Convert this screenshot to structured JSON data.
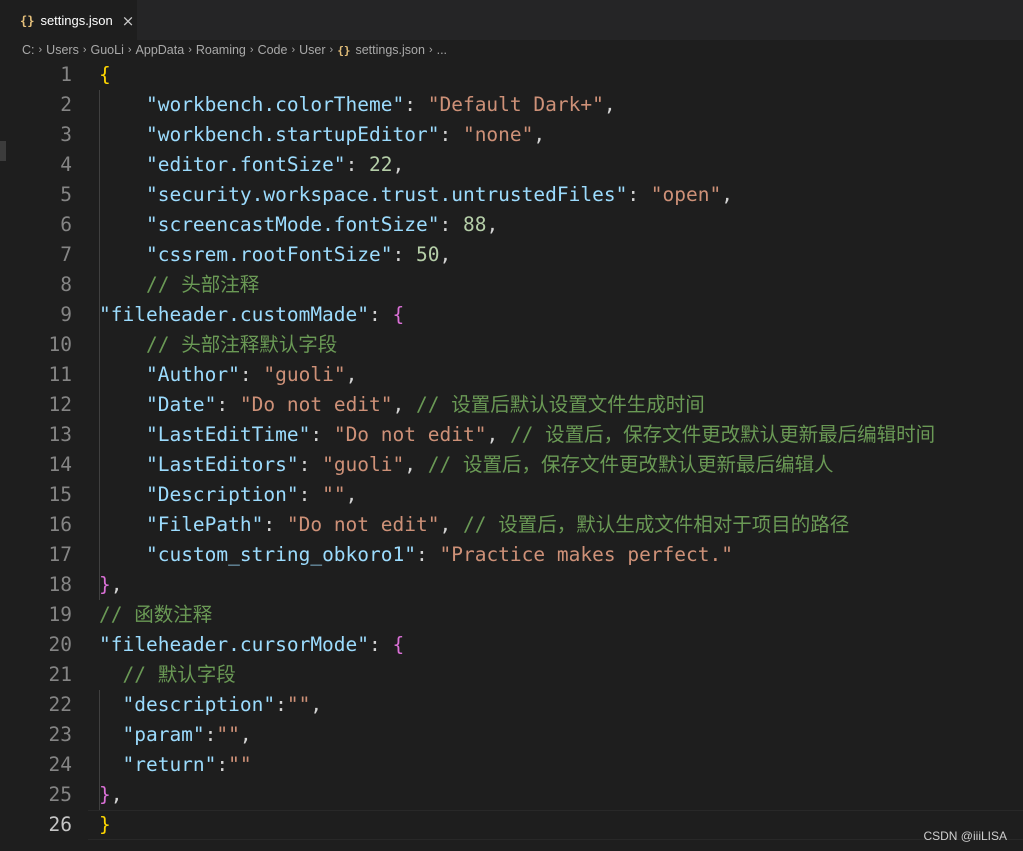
{
  "tab": {
    "icon": "{}",
    "label": "settings.json",
    "close": "×"
  },
  "breadcrumb": {
    "items": [
      "C:",
      "Users",
      "GuoLi",
      "AppData",
      "Roaming",
      "Code",
      "User"
    ],
    "file_icon": "{}",
    "file": "settings.json",
    "more": "..."
  },
  "lines": [
    {
      "n": "1",
      "tokens": [
        {
          "t": "{",
          "c": "b1"
        }
      ]
    },
    {
      "n": "2",
      "tokens": [
        {
          "t": "    "
        },
        {
          "t": "\"workbench.colorTheme\"",
          "c": "k"
        },
        {
          "t": ": ",
          "c": "p"
        },
        {
          "t": "\"Default Dark+\"",
          "c": "s"
        },
        {
          "t": ",",
          "c": "p"
        }
      ]
    },
    {
      "n": "3",
      "tokens": [
        {
          "t": "    "
        },
        {
          "t": "\"workbench.startupEditor\"",
          "c": "k"
        },
        {
          "t": ": ",
          "c": "p"
        },
        {
          "t": "\"none\"",
          "c": "s"
        },
        {
          "t": ",",
          "c": "p"
        }
      ]
    },
    {
      "n": "4",
      "tokens": [
        {
          "t": "    "
        },
        {
          "t": "\"editor.fontSize\"",
          "c": "k"
        },
        {
          "t": ": ",
          "c": "p"
        },
        {
          "t": "22",
          "c": "n"
        },
        {
          "t": ",",
          "c": "p"
        }
      ]
    },
    {
      "n": "5",
      "tokens": [
        {
          "t": "    "
        },
        {
          "t": "\"security.workspace.trust.untrustedFiles\"",
          "c": "k"
        },
        {
          "t": ": ",
          "c": "p"
        },
        {
          "t": "\"open\"",
          "c": "s"
        },
        {
          "t": ",",
          "c": "p"
        }
      ]
    },
    {
      "n": "6",
      "tokens": [
        {
          "t": "    "
        },
        {
          "t": "\"screencastMode.fontSize\"",
          "c": "k"
        },
        {
          "t": ": ",
          "c": "p"
        },
        {
          "t": "88",
          "c": "n"
        },
        {
          "t": ",",
          "c": "p"
        }
      ]
    },
    {
      "n": "7",
      "tokens": [
        {
          "t": "    "
        },
        {
          "t": "\"cssrem.rootFontSize\"",
          "c": "k"
        },
        {
          "t": ": ",
          "c": "p"
        },
        {
          "t": "50",
          "c": "n"
        },
        {
          "t": ",",
          "c": "p"
        }
      ]
    },
    {
      "n": "8",
      "tokens": [
        {
          "t": "    "
        },
        {
          "t": "// 头部注释",
          "c": "c"
        }
      ]
    },
    {
      "n": "9",
      "tokens": [
        {
          "t": "\"fileheader.customMade\"",
          "c": "k"
        },
        {
          "t": ": ",
          "c": "p"
        },
        {
          "t": "{",
          "c": "b2"
        }
      ]
    },
    {
      "n": "10",
      "tokens": [
        {
          "t": "    "
        },
        {
          "t": "// 头部注释默认字段",
          "c": "c"
        }
      ]
    },
    {
      "n": "11",
      "tokens": [
        {
          "t": "    "
        },
        {
          "t": "\"Author\"",
          "c": "k"
        },
        {
          "t": ": ",
          "c": "p"
        },
        {
          "t": "\"guoli\"",
          "c": "s"
        },
        {
          "t": ",",
          "c": "p"
        }
      ]
    },
    {
      "n": "12",
      "tokens": [
        {
          "t": "    "
        },
        {
          "t": "\"Date\"",
          "c": "k"
        },
        {
          "t": ": ",
          "c": "p"
        },
        {
          "t": "\"Do not edit\"",
          "c": "s"
        },
        {
          "t": ", ",
          "c": "p"
        },
        {
          "t": "// 设置后默认设置文件生成时间",
          "c": "c"
        }
      ]
    },
    {
      "n": "13",
      "tokens": [
        {
          "t": "    "
        },
        {
          "t": "\"LastEditTime\"",
          "c": "k"
        },
        {
          "t": ": ",
          "c": "p"
        },
        {
          "t": "\"Do not edit\"",
          "c": "s"
        },
        {
          "t": ", ",
          "c": "p"
        },
        {
          "t": "// 设置后，保存文件更改默认更新最后编辑时间",
          "c": "c"
        }
      ]
    },
    {
      "n": "14",
      "tokens": [
        {
          "t": "    "
        },
        {
          "t": "\"LastEditors\"",
          "c": "k"
        },
        {
          "t": ": ",
          "c": "p"
        },
        {
          "t": "\"guoli\"",
          "c": "s"
        },
        {
          "t": ", ",
          "c": "p"
        },
        {
          "t": "// 设置后，保存文件更改默认更新最后编辑人",
          "c": "c"
        }
      ]
    },
    {
      "n": "15",
      "tokens": [
        {
          "t": "    "
        },
        {
          "t": "\"Description\"",
          "c": "k"
        },
        {
          "t": ": ",
          "c": "p"
        },
        {
          "t": "\"\"",
          "c": "s"
        },
        {
          "t": ",",
          "c": "p"
        }
      ]
    },
    {
      "n": "16",
      "tokens": [
        {
          "t": "    "
        },
        {
          "t": "\"FilePath\"",
          "c": "k"
        },
        {
          "t": ": ",
          "c": "p"
        },
        {
          "t": "\"Do not edit\"",
          "c": "s"
        },
        {
          "t": ", ",
          "c": "p"
        },
        {
          "t": "// 设置后，默认生成文件相对于项目的路径",
          "c": "c"
        }
      ]
    },
    {
      "n": "17",
      "tokens": [
        {
          "t": "    "
        },
        {
          "t": "\"custom_string_obkoro1\"",
          "c": "k"
        },
        {
          "t": ": ",
          "c": "p"
        },
        {
          "t": "\"Practice makes perfect.\"",
          "c": "s"
        }
      ]
    },
    {
      "n": "18",
      "tokens": [
        {
          "t": "}",
          "c": "b2"
        },
        {
          "t": ",",
          "c": "p"
        }
      ]
    },
    {
      "n": "19",
      "tokens": [
        {
          "t": "// 函数注释",
          "c": "c"
        }
      ]
    },
    {
      "n": "20",
      "tokens": [
        {
          "t": "\"fileheader.cursorMode\"",
          "c": "k"
        },
        {
          "t": ": ",
          "c": "p"
        },
        {
          "t": "{",
          "c": "b2"
        }
      ]
    },
    {
      "n": "21",
      "tokens": [
        {
          "t": "  "
        },
        {
          "t": "// 默认字段",
          "c": "c"
        }
      ]
    },
    {
      "n": "22",
      "tokens": [
        {
          "t": "  "
        },
        {
          "t": "\"description\"",
          "c": "k"
        },
        {
          "t": ":",
          "c": "p"
        },
        {
          "t": "\"\"",
          "c": "s"
        },
        {
          "t": ",",
          "c": "p"
        }
      ]
    },
    {
      "n": "23",
      "tokens": [
        {
          "t": "  "
        },
        {
          "t": "\"param\"",
          "c": "k"
        },
        {
          "t": ":",
          "c": "p"
        },
        {
          "t": "\"\"",
          "c": "s"
        },
        {
          "t": ",",
          "c": "p"
        }
      ]
    },
    {
      "n": "24",
      "tokens": [
        {
          "t": "  "
        },
        {
          "t": "\"return\"",
          "c": "k"
        },
        {
          "t": ":",
          "c": "p"
        },
        {
          "t": "\"\"",
          "c": "s"
        }
      ]
    },
    {
      "n": "25",
      "tokens": [
        {
          "t": "}",
          "c": "b2"
        },
        {
          "t": ",",
          "c": "p"
        }
      ]
    },
    {
      "n": "26",
      "tokens": [
        {
          "t": "}",
          "c": "b1"
        }
      ],
      "active": true
    }
  ],
  "watermark": "CSDN @iiiLISA"
}
